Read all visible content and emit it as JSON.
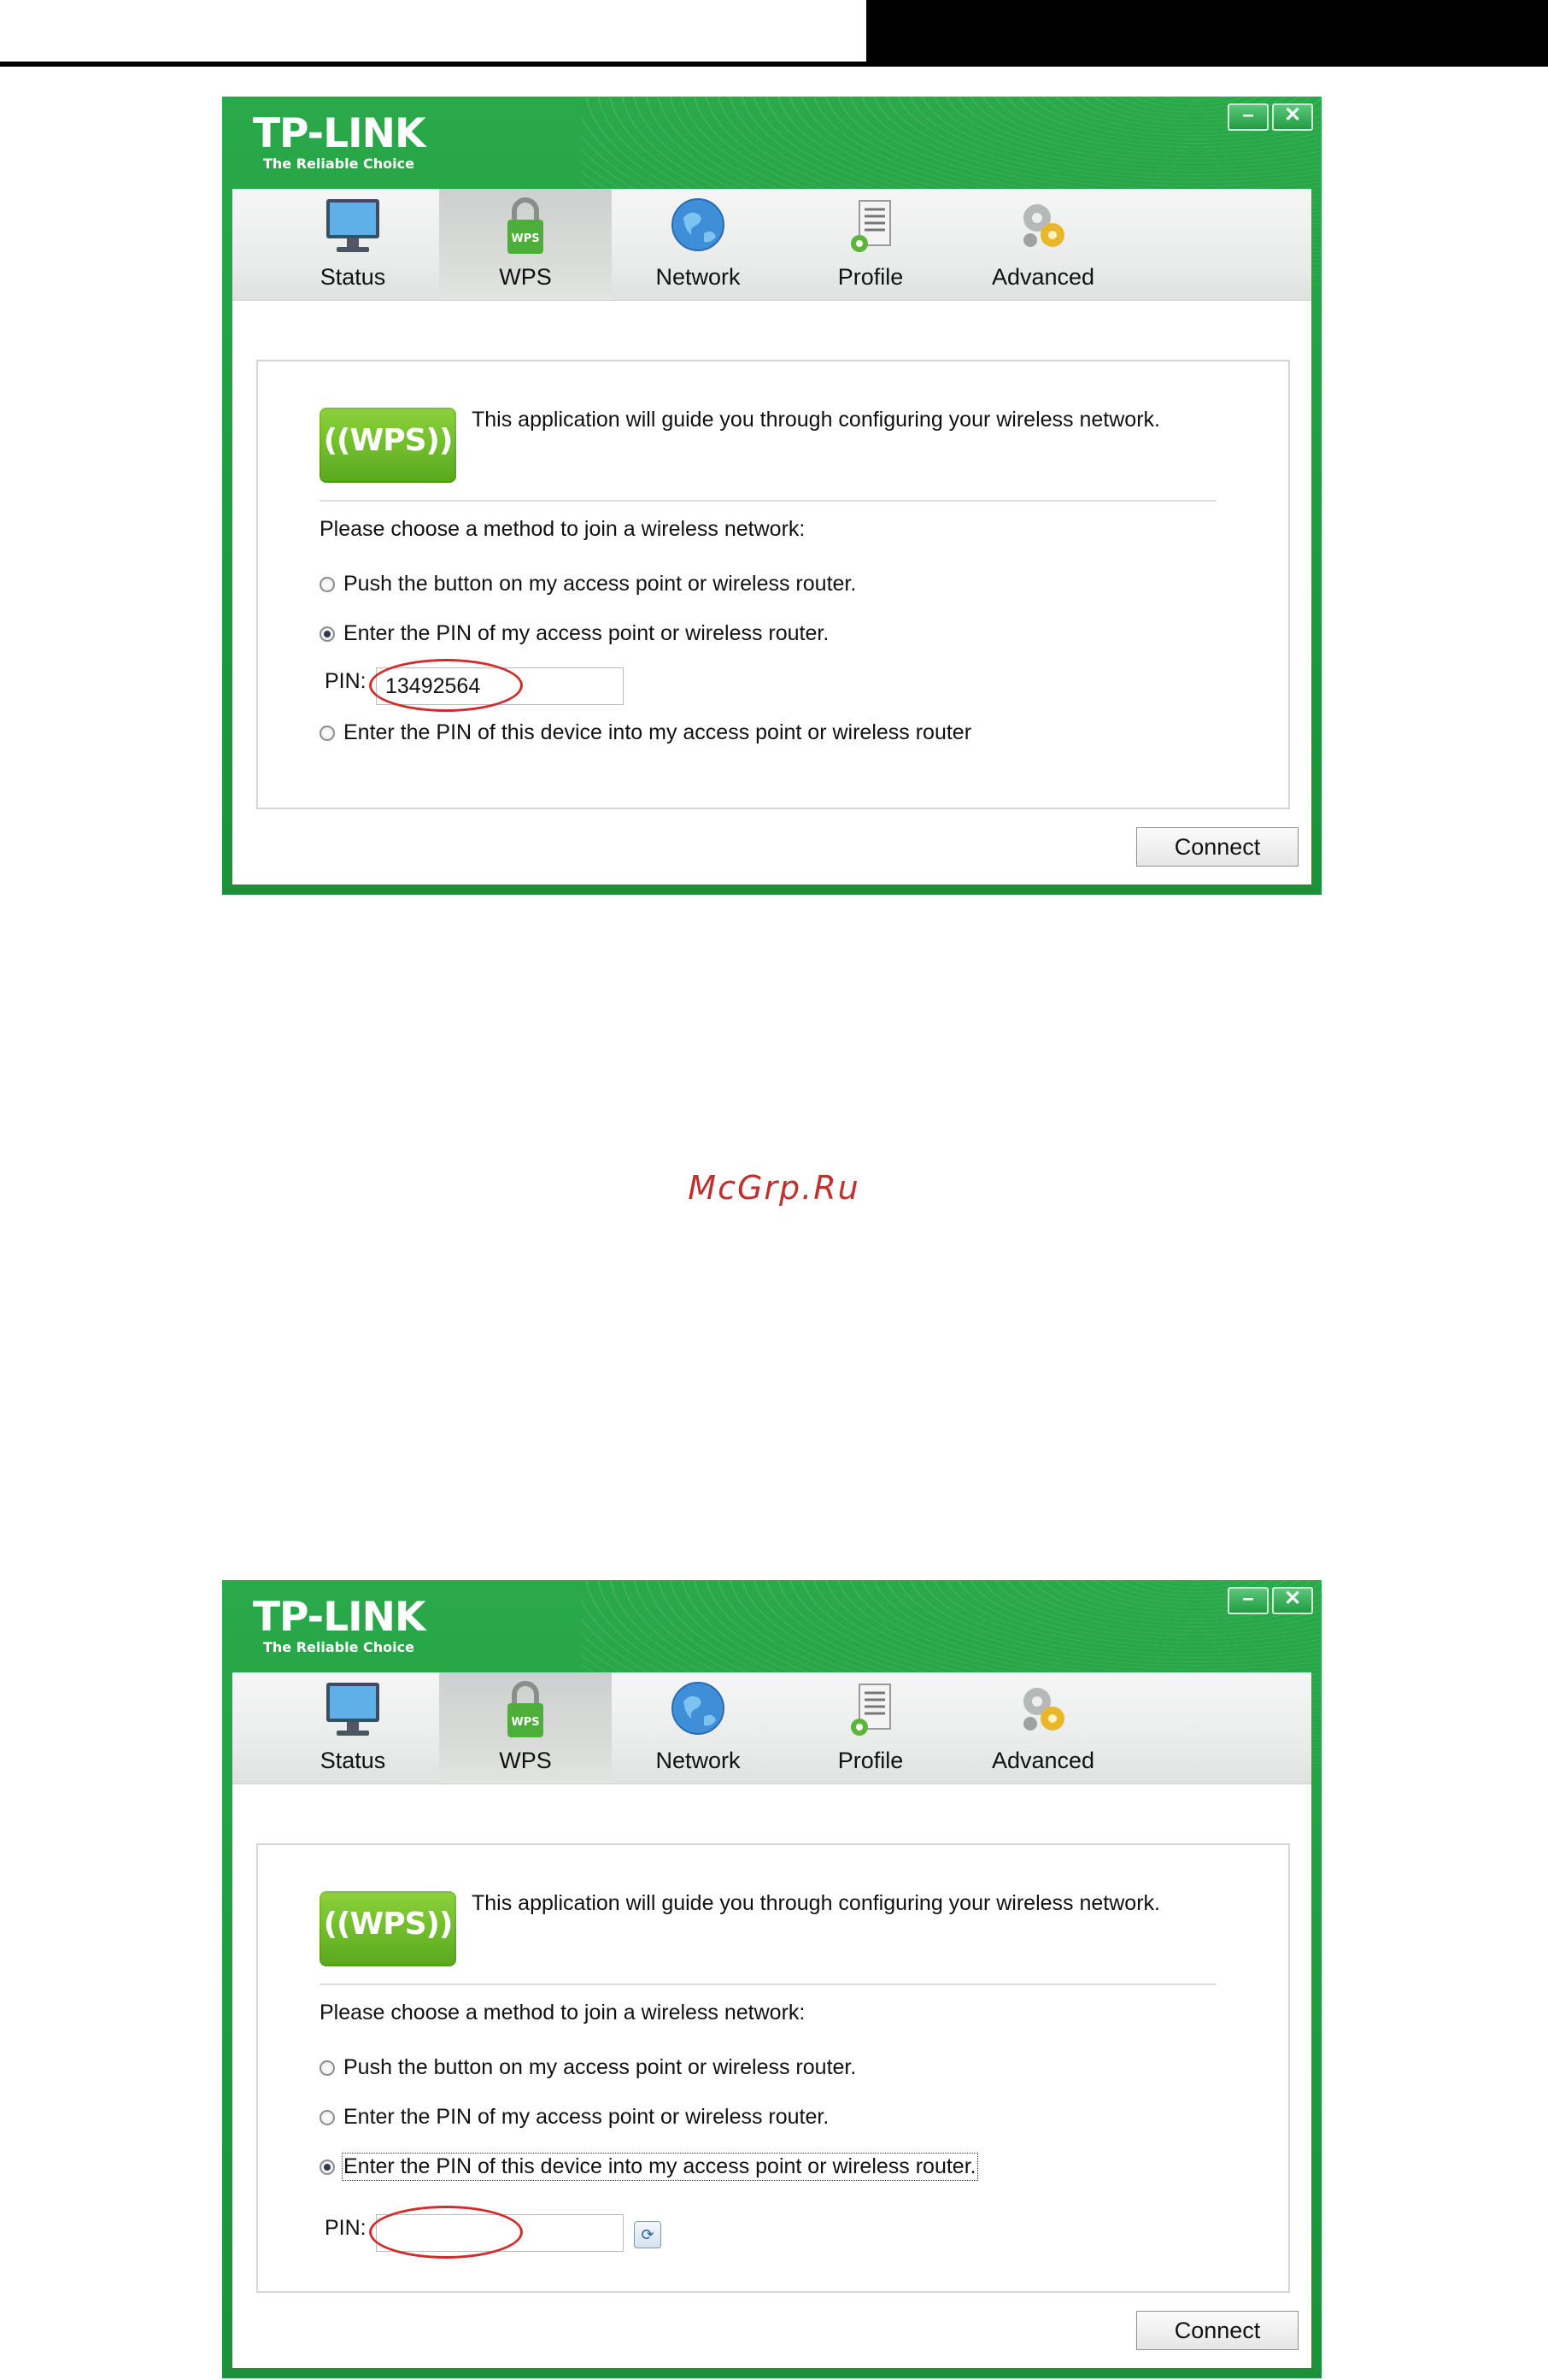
{
  "watermark": "McGrp.Ru",
  "windows": [
    {
      "brand": "TP-LINK",
      "tagline": "The Reliable Choice",
      "tabs": [
        {
          "label": "Status"
        },
        {
          "label": "WPS"
        },
        {
          "label": "Network"
        },
        {
          "label": "Profile"
        },
        {
          "label": "Advanced"
        }
      ],
      "active_tab": "WPS",
      "wps_logo_text": "((WPS))",
      "intro": "This application will guide you through configuring your wireless network.",
      "choose_text": "Please choose a method to join a wireless network:",
      "options": [
        {
          "label": "Push the button on my access point or wireless router.",
          "selected": false
        },
        {
          "label": "Enter the PIN of my access point or wireless router.",
          "selected": true
        },
        {
          "label": "Enter the PIN of this device into my access point or wireless router",
          "selected": false
        }
      ],
      "pin_label": "PIN:",
      "pin_value": "13492564",
      "connect_label": "Connect",
      "minimize_label": "–",
      "close_label": "✕"
    },
    {
      "brand": "TP-LINK",
      "tagline": "The Reliable Choice",
      "tabs": [
        {
          "label": "Status"
        },
        {
          "label": "WPS"
        },
        {
          "label": "Network"
        },
        {
          "label": "Profile"
        },
        {
          "label": "Advanced"
        }
      ],
      "active_tab": "WPS",
      "wps_logo_text": "((WPS))",
      "intro": "This application will guide you through configuring your wireless network.",
      "choose_text": "Please choose a method to join a wireless network:",
      "options": [
        {
          "label": "Push the button on my access point or wireless router.",
          "selected": false
        },
        {
          "label": "Enter the PIN of my access point or wireless router.",
          "selected": false
        },
        {
          "label": "Enter the PIN of this device into my access point or wireless router.",
          "selected": true
        }
      ],
      "pin_label": "PIN:",
      "pin_value": "",
      "connect_label": "Connect",
      "minimize_label": "–",
      "close_label": "✕"
    }
  ],
  "colors": {
    "brand_green": "#1f9a3e",
    "highlight_ring": "#d22b2b"
  }
}
